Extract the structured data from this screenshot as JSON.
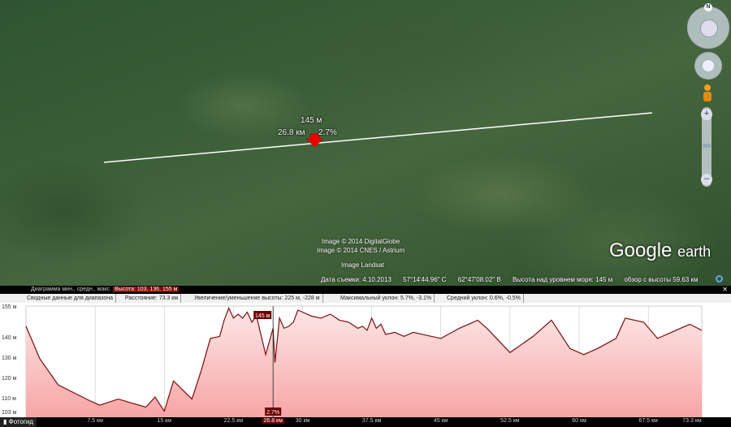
{
  "map": {
    "marker": {
      "height": "145 м",
      "distance": "26.8 км",
      "slope": "2.7%"
    },
    "copyright": [
      "Image © 2014 DigitalGlobe",
      "Image © 2014 CNES / Astrium",
      "Image Landsat"
    ],
    "brand": {
      "google": "Google",
      "earth": "earth"
    },
    "status": {
      "date": "Дата съемки: 4.10.2013",
      "lat": "57°14'44.96\" С",
      "lon": "62°47'08.02\" В",
      "elev": "Высота над уровнем моря:  145 м",
      "eye": "обзор с высоты  59.63 км"
    },
    "compass_n": "N",
    "zoom_plus": "+",
    "zoom_minus": "–"
  },
  "profile": {
    "diagram_label": "Диаграмма  мин., средн., макс.",
    "height_stat": "Высота: 103, 136, 155 м",
    "summary_label": "Сводные данные для диапазона",
    "distance": "Расстояние: 73.3 км",
    "gain_loss": "Увеличение/уменьшение высоты: 225 м, -228 м",
    "max_slope": "Максимальный уклон: 5.7%, -3.1%",
    "avg_slope": "Средний уклон: 0.6%, -0.5%",
    "close": "✕",
    "photo_button": "Фотогид",
    "cursor_height": "145 м",
    "cursor_slope": "2.7%",
    "cursor_dist": "26.8 км",
    "end_dist": "73.3 км"
  },
  "chart_data": {
    "type": "area",
    "xlabel": "км",
    "ylabel": "м",
    "xlim": [
      0,
      73.3
    ],
    "ylim": [
      101,
      156
    ],
    "x_ticks": [
      "7.5 км",
      "15 км",
      "22.5 км",
      "30 км",
      "37.5 км",
      "45 км",
      "52.5 км",
      "60 км",
      "67.5 км"
    ],
    "x_tick_values": [
      7.5,
      15,
      22.5,
      30,
      37.5,
      45,
      52.5,
      60,
      67.5
    ],
    "y_ticks": [
      "155 м",
      "140 м",
      "130 м",
      "120 м",
      "110 м",
      "103 м"
    ],
    "y_tick_values": [
      155,
      140,
      130,
      120,
      110,
      103
    ],
    "series": [
      {
        "x": [
          0,
          1.5,
          3.5,
          7,
          8,
          10,
          11.5,
          13,
          14,
          15,
          16,
          18,
          19,
          20,
          21,
          21.5,
          22,
          22.5,
          23,
          23.5,
          24,
          24.5,
          25,
          26,
          26.8,
          27,
          27.5,
          28,
          28.5,
          29,
          29.5,
          30,
          31,
          32,
          33,
          34,
          35,
          36,
          36.5,
          37,
          37.5,
          38,
          38.5,
          39,
          40,
          41,
          42,
          43,
          45,
          47,
          49,
          50,
          52.5,
          55,
          57,
          59,
          60.5,
          62,
          64,
          65,
          67,
          68.5,
          70,
          72,
          73.3
        ],
        "y": [
          146,
          130,
          117,
          109,
          107,
          110,
          108,
          106,
          111,
          104,
          119,
          110,
          124,
          140,
          141,
          149,
          155,
          150,
          152,
          150,
          153,
          148,
          151,
          132,
          145,
          128,
          150,
          145,
          146,
          148,
          154,
          153,
          151,
          150,
          152,
          149,
          148,
          145,
          146,
          144,
          150,
          145,
          147,
          142,
          143,
          141,
          143,
          142,
          140,
          145,
          149,
          145,
          133,
          141,
          149,
          135,
          132,
          135,
          140,
          150,
          148,
          140,
          143,
          147,
          144
        ]
      }
    ],
    "cursor_x": 26.8,
    "grid": true
  }
}
